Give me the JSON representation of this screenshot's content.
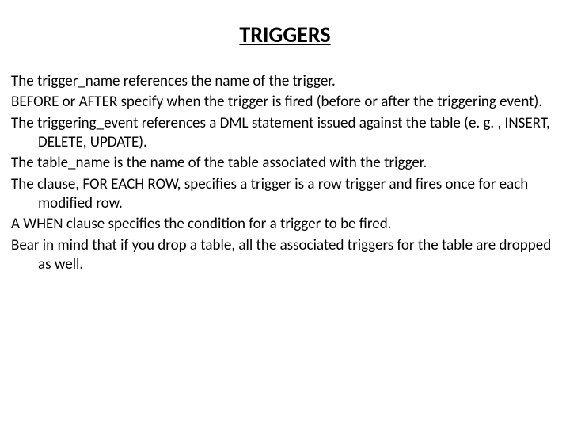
{
  "title": "TRIGGERS",
  "paras": {
    "p0": "The trigger_name references the name of the trigger.",
    "p1": "BEFORE or AFTER specify when the trigger is fired (before or after the triggering event).",
    "p2": "The triggering_event references a DML statement issued against the table (e. g. , INSERT, DELETE, UPDATE).",
    "p3": "The table_name is the name of the table associated with the trigger.",
    "p4": "The clause, FOR EACH ROW, specifies a trigger is a row trigger and fires once for each modified row.",
    "p5": "A WHEN clause specifies the condition for a trigger to be fired.",
    "p6": "Bear in mind that if you drop a table, all the associated triggers for the table are dropped as well."
  }
}
